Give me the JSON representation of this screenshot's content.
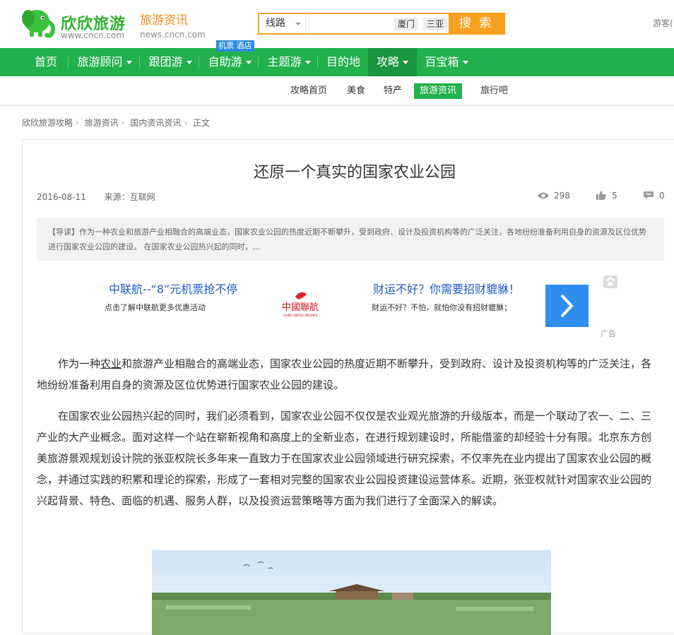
{
  "header": {
    "brand": "欣欣旅游",
    "brand_url": "www.cncn.com",
    "channel_name": "旅游资讯",
    "channel_url": "news.cncn.com",
    "search": {
      "type_label": "线路",
      "placeholder": "",
      "hot_tags": [
        "厦门",
        "三亚"
      ],
      "button_label": "搜 索"
    },
    "guest_text": "游客("
  },
  "nav": {
    "badge": "机票 酒店",
    "items": [
      {
        "label": "首页"
      },
      {
        "label": "旅游顾问"
      },
      {
        "label": "跟团游"
      },
      {
        "label": "自助游"
      },
      {
        "label": "主题游"
      },
      {
        "label": "目的地"
      },
      {
        "label": "攻略"
      },
      {
        "label": "百宝箱"
      }
    ]
  },
  "subnav": {
    "items": [
      {
        "label": "攻略首页"
      },
      {
        "label": "美食"
      },
      {
        "label": "特产"
      },
      {
        "label": "旅游资讯"
      },
      {
        "label": "旅行吧"
      }
    ]
  },
  "breadcrumb": [
    "欣欣旅游攻略",
    "旅游资讯",
    "国内资讯资讯",
    "正文"
  ],
  "article": {
    "title": "还原一个真实的国家农业公园",
    "date": "2016-08-11",
    "source": "来源：互联网",
    "views": "298",
    "likes": "5",
    "comments": "0",
    "lead": "【导读】作为一种农业和旅游产业相融合的高端业态，国家农业公园的热度近期不断攀升，受到政府、设计及投资机构等的广泛关注，各地纷纷准备利用自身的资源及区位优势进行国家农业公园的建设。 在国家农业公园热兴起的同时，...",
    "para1_pre": "作为一种",
    "para1_link": "农业",
    "para1_post": "和旅游产业相融合的高端业态，国家农业公园的热度近期不断攀升，受到政府、设计及投资机构等的广泛关注，各地纷纷准备利用自身的资源及区位优势进行国家农业公园的建设。",
    "para2": "在国家农业公园热兴起的同时，我们必须看到，国家农业公园不仅仅是农业观光旅游的升级版本，而是一个联动了农一、二、三产业的大产业概念。面对这样一个站在崭新视角和高度上的全新业态，在进行规划建设时，所能借鉴的却经验十分有限。北京东方创美旅游景观规划设计院的张亚权院长多年来一直致力于在国家农业公园领域进行研究探索，不仅率先在业内提出了国家农业公园的概念，并通过实践的积累和理论的探索，形成了一套相对完整的国家农业公园投资建设运营体系。近期，张亚权就针对国家农业公园的兴起背景、特色、面临的机遇、服务人群，以及投资运营策略等方面为我们进行了全面深入的解读。"
  },
  "ad": {
    "title1": "中联航--“8”元机票抢不停",
    "desc1": "点击了解中联航更多优惠活动",
    "cua_cn": "中國聯航",
    "cua_en": "CHINA UNITED AIRLINES",
    "title2": "财运不好？你需要招财貔貅！",
    "desc2": "财运不好？不怕，就怕你没有招财貔貅；",
    "label": "广告"
  },
  "colors": {
    "brand_green": "#22b14c",
    "nav_active": "#1a9640",
    "search_orange": "#f6a11e",
    "channel_orange": "#ef8a21",
    "ad_blue": "#1f5bc8",
    "badge_blue": "#2b8ce0"
  },
  "icons": [
    "elephant-logo-icon",
    "eye-icon",
    "thumbs-up-icon",
    "comment-icon",
    "chevron-right-icon",
    "paw-icon",
    "caret-down-icon"
  ]
}
